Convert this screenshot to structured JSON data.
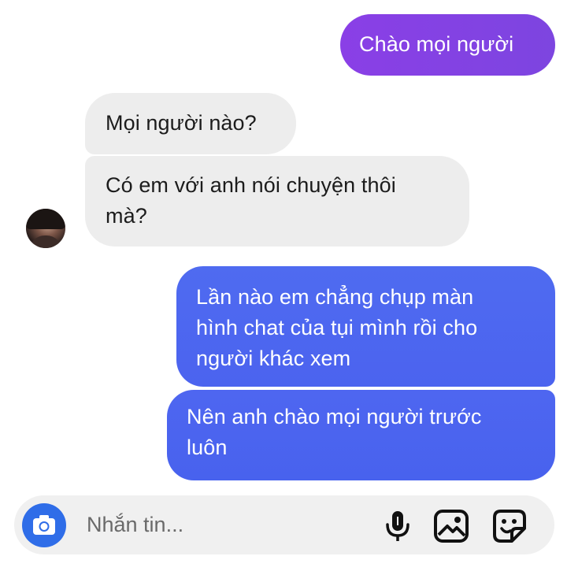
{
  "messages": [
    {
      "id": "m1",
      "direction": "outgoing",
      "lines": [
        "Chào mọi người"
      ]
    },
    {
      "id": "m2",
      "direction": "incoming",
      "lines": [
        "Mọi người nào?"
      ]
    },
    {
      "id": "m3",
      "direction": "incoming",
      "lines": [
        "Có em với anh nói chuyện thôi",
        "mà?"
      ]
    },
    {
      "id": "m4",
      "direction": "outgoing",
      "lines": [
        "Lần nào em chẳng chụp màn",
        "hình chat của tụi mình rồi cho",
        "người khác xem"
      ]
    },
    {
      "id": "m5",
      "direction": "outgoing",
      "lines": [
        "Nên anh chào mọi người trước",
        "luôn"
      ]
    }
  ],
  "composer": {
    "placeholder": "Nhắn tin...",
    "icons": [
      "camera-icon",
      "microphone-icon",
      "image-icon",
      "sticker-icon"
    ]
  },
  "colors": {
    "outgoing_purple": "#8a3fe6",
    "outgoing_blue": "#4d66f0",
    "incoming_bg": "#ededed",
    "camera_button": "#2f6de8",
    "composer_bg": "#f0f0f0"
  }
}
